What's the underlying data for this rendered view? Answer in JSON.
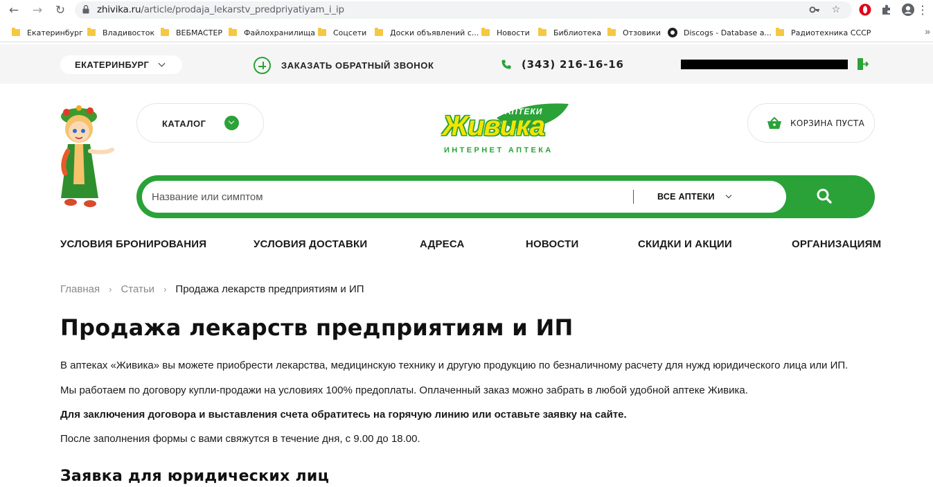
{
  "browser": {
    "url_domain": "zhivika.ru",
    "url_path": "/article/prodaja_lekarstv_predpriyatiyam_i_ip",
    "bookmarks": [
      {
        "label": "Екатеринбург",
        "icon": "folder-icon"
      },
      {
        "label": "Владивосток",
        "icon": "folder-icon"
      },
      {
        "label": "ВЕБМАСТЕР",
        "icon": "folder-icon"
      },
      {
        "label": "Файлохранилища",
        "icon": "folder-icon"
      },
      {
        "label": "Соцсети",
        "icon": "folder-icon"
      },
      {
        "label": "Доски объявлений с...",
        "icon": "folder-icon"
      },
      {
        "label": "Новости",
        "icon": "folder-icon"
      },
      {
        "label": "Библиотека",
        "icon": "folder-icon"
      },
      {
        "label": "Отзовики",
        "icon": "folder-icon"
      },
      {
        "label": "Discogs - Database a...",
        "icon": "discogs-icon"
      },
      {
        "label": "Радиотехника СССР",
        "icon": "folder-icon"
      }
    ]
  },
  "topbar": {
    "city": "ЕКАТЕРИНБУРГ",
    "callback": "ЗАКАЗАТЬ ОБРАТНЫЙ ЗВОНОК",
    "phone": "(343) 216-16-16"
  },
  "header": {
    "catalog": "КАТАЛОГ",
    "logo_top": "АПТЕКИ",
    "logo_main": "Живика",
    "logo_sub": "ИНТЕРНЕТ АПТЕКА",
    "cart": "КОРЗИНА ПУСТА",
    "brand_green": "#2aa238",
    "brand_yellow": "#f2e500"
  },
  "search": {
    "placeholder": "Название или симптом",
    "pharmacy_select": "ВСЕ АПТЕКИ"
  },
  "nav": [
    "УСЛОВИЯ БРОНИРОВАНИЯ",
    "УСЛОВИЯ ДОСТАВКИ",
    "АДРЕСА",
    "НОВОСТИ",
    "СКИДКИ И АКЦИИ",
    "ОРГАНИЗАЦИЯМ"
  ],
  "breadcrumb": {
    "home": "Главная",
    "articles": "Статьи",
    "current": "Продажа лекарств предприятиям и ИП"
  },
  "content": {
    "title": "Продажа лекарств предприятиям и ИП",
    "p1": "В аптеках «Живика» вы можете приобрести лекарства, медицинскую технику и другую продукцию по безналичному расчету для нужд юридического лица или ИП.",
    "p2": "Мы работаем по договору купли-продажи на условиях 100% предоплаты. Оплаченный заказ можно забрать в любой удобной аптеке Живика.",
    "p3": "Для заключения договора и выставления счета обратитесь на горячую линию или оставьте заявку на сайте.",
    "p4": "После заполнения формы с вами свяжутся в течение дня, с 9.00 до 18.00.",
    "subtitle": "Заявка для юридических лиц"
  }
}
